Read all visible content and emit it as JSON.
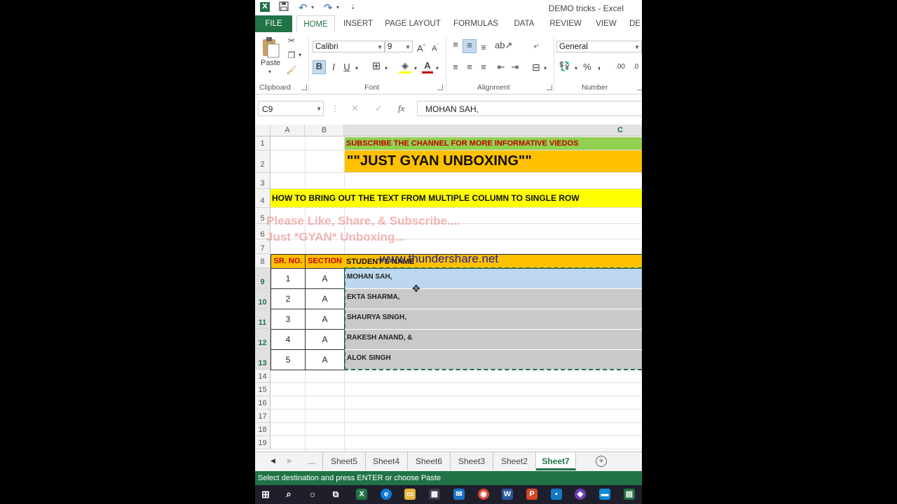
{
  "window": {
    "title": "DEMO tricks - Excel"
  },
  "tabs": [
    "FILE",
    "HOME",
    "INSERT",
    "PAGE LAYOUT",
    "FORMULAS",
    "DATA",
    "REVIEW",
    "VIEW",
    "DE"
  ],
  "ribbon": {
    "paste_label": "Paste",
    "font_name": "Calibri",
    "font_size": "9",
    "grow_font": "A",
    "shrink_font": "A",
    "bold": "B",
    "italic": "I",
    "underline": "U",
    "font_color_glyph": "A",
    "number_format": "General",
    "percent": "%",
    "comma": ",",
    "group_clipboard": "Clipboard",
    "group_font": "Font",
    "group_alignment": "Alignment",
    "group_number": "Number"
  },
  "formula_bar": {
    "name_box": "C9",
    "formula": "MOHAN SAH,",
    "fx": "fx"
  },
  "columns": [
    "A",
    "B",
    "C"
  ],
  "rows": [
    "1",
    "2",
    "3",
    "4",
    "5",
    "6",
    "7",
    "8",
    "9",
    "10",
    "11",
    "12",
    "13",
    "14",
    "15",
    "16",
    "17",
    "18",
    "19"
  ],
  "cells": {
    "c1": "SUBSCRIBE THE CHANNEL FOR MORE INFORMATIVE VIEDOS",
    "c2": "\"\"JUST GYAN UNBOXING\"\"",
    "a4": "HOW TO BRING OUT THE TEXT FROM MULTIPLE COLUMN TO SINGLE ROW",
    "overlay_line1": "Please Like, Share, & Subscribe....",
    "overlay_line2": "Just *GYAN* Unboxing...",
    "watermark": "www.thundershare.net",
    "hdr_srno": "SR. NO.",
    "hdr_section": "SECTION",
    "hdr_student": "STUDENT'S NAME"
  },
  "students": [
    {
      "no": "1",
      "section": "A",
      "name": "MOHAN SAH,"
    },
    {
      "no": "2",
      "section": "A",
      "name": "EKTA SHARMA,"
    },
    {
      "no": "3",
      "section": "A",
      "name": "SHAURYA SINGH,"
    },
    {
      "no": "4",
      "section": "A",
      "name": "RAKESH ANAND, &"
    },
    {
      "no": "5",
      "section": "A",
      "name": "ALOK SINGH"
    }
  ],
  "sheets": {
    "more": "...",
    "names": [
      "Sheet5",
      "Sheet4",
      "Sheet6",
      "Sheet3",
      "Sheet2",
      "Sheet7"
    ],
    "active": "Sheet7"
  },
  "status": "Select destination and press ENTER or choose Paste",
  "colors": {
    "excel_green": "#217346",
    "title_green": "#92d050",
    "orange": "#ffc000",
    "yellow": "#ffff00",
    "selected_cell": "#bdd7ee",
    "copy_fill": "#c9c9c9"
  }
}
